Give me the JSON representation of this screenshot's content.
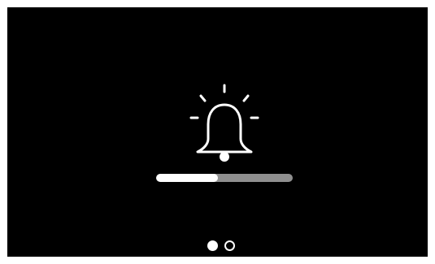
{
  "screen": {
    "background": "#000000",
    "icon": "bell-icon",
    "progress": {
      "value": 0.45,
      "fill_color": "#ffffff",
      "track_color": "#8f8f8f"
    },
    "pager": {
      "total": 2,
      "current": 1
    }
  }
}
